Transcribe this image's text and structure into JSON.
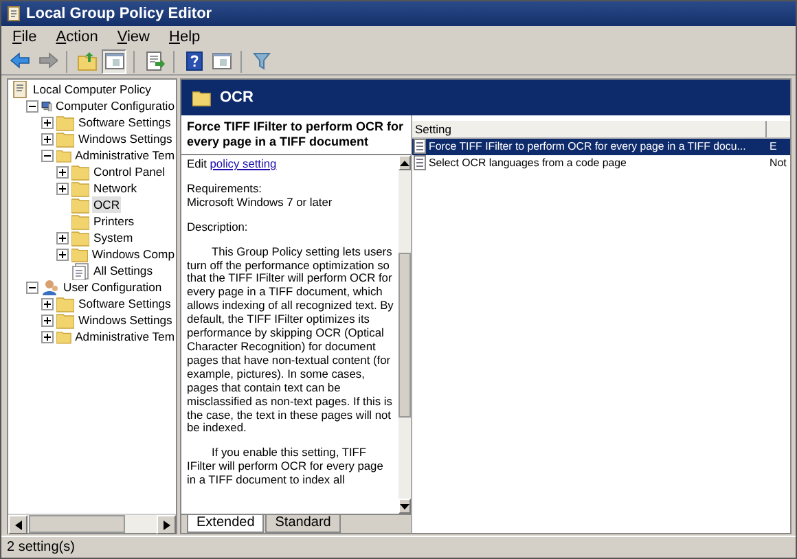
{
  "window": {
    "title": "Local Group Policy Editor"
  },
  "menu": [
    "File",
    "Action",
    "View",
    "Help"
  ],
  "toolbar": [
    {
      "kind": "back",
      "pressed": false
    },
    {
      "kind": "forward",
      "pressed": false
    },
    {
      "kind": "separator"
    },
    {
      "kind": "up",
      "pressed": false
    },
    {
      "kind": "tree",
      "pressed": true
    },
    {
      "kind": "separator"
    },
    {
      "kind": "export",
      "pressed": false
    },
    {
      "kind": "separator"
    },
    {
      "kind": "help",
      "pressed": false
    },
    {
      "kind": "pane",
      "pressed": false
    },
    {
      "kind": "separator"
    },
    {
      "kind": "filter",
      "pressed": false
    }
  ],
  "tree": [
    {
      "label": "Local Computer Policy",
      "kind": "root",
      "selected": false,
      "children": [
        {
          "label": "Computer Configuratio",
          "kind": "computer",
          "expanded": true,
          "selected": false,
          "children": [
            {
              "label": "Software Settings",
              "kind": "folder",
              "expanded": false,
              "selected": false
            },
            {
              "label": "Windows Settings",
              "kind": "folder",
              "expanded": false,
              "selected": false
            },
            {
              "label": "Administrative Tem",
              "kind": "folder",
              "expanded": true,
              "selected": false,
              "children": [
                {
                  "label": "Control Panel",
                  "kind": "folder",
                  "expanded": false,
                  "selected": false
                },
                {
                  "label": "Network",
                  "kind": "folder",
                  "expanded": false,
                  "selected": false
                },
                {
                  "label": "OCR",
                  "kind": "folder",
                  "selected": true
                },
                {
                  "label": "Printers",
                  "kind": "folder",
                  "selected": false
                },
                {
                  "label": "System",
                  "kind": "folder",
                  "expanded": false,
                  "selected": false
                },
                {
                  "label": "Windows Comp",
                  "kind": "folder",
                  "expanded": false,
                  "selected": false
                },
                {
                  "label": "All Settings",
                  "kind": "all-settings",
                  "selected": false
                }
              ]
            }
          ]
        },
        {
          "label": "User Configuration",
          "kind": "user",
          "expanded": true,
          "selected": false,
          "children": [
            {
              "label": "Software Settings",
              "kind": "folder",
              "expanded": false,
              "selected": false
            },
            {
              "label": "Windows Settings",
              "kind": "folder",
              "expanded": false,
              "selected": false
            },
            {
              "label": "Administrative Tem",
              "kind": "folder",
              "expanded": false,
              "selected": false
            }
          ]
        }
      ]
    }
  ],
  "header": {
    "title": "OCR"
  },
  "description": {
    "title": "Force TIFF IFilter to perform OCR for every page in a TIFF document",
    "edit_prefix": "Edit",
    "edit_link": "policy setting",
    "requirements_label": "Requirements:",
    "requirements": "Microsoft Windows 7 or later",
    "description_label": "Description:",
    "paragraphs": [
      "This Group Policy setting lets users turn off the performance optimization so that the TIFF IFilter will perform OCR for every page in a TIFF document, which allows indexing of all recognized text. By default, the TIFF IFilter optimizes its performance by skipping OCR (Optical Character Recognition) for document pages that have non-textual content (for example, pictures). In some cases, pages that contain text can be misclassified as non-text pages. If this is the case, the text in these pages will not be indexed.",
      "If you enable this setting, TIFF IFilter will perform OCR for every page in a TIFF document to index all"
    ]
  },
  "view_tabs": [
    {
      "label": "Extended",
      "selected": true
    },
    {
      "label": "Standard",
      "selected": false
    }
  ],
  "table": {
    "columns": [
      "Setting"
    ],
    "rows": [
      {
        "setting": "Force TIFF IFilter to perform OCR for every page in a TIFF docu...",
        "column_2": "E",
        "selected": true
      },
      {
        "setting": "Select OCR languages from a code page",
        "column_2": "Not",
        "selected": false
      }
    ]
  },
  "status_bar": "2 setting(s)"
}
